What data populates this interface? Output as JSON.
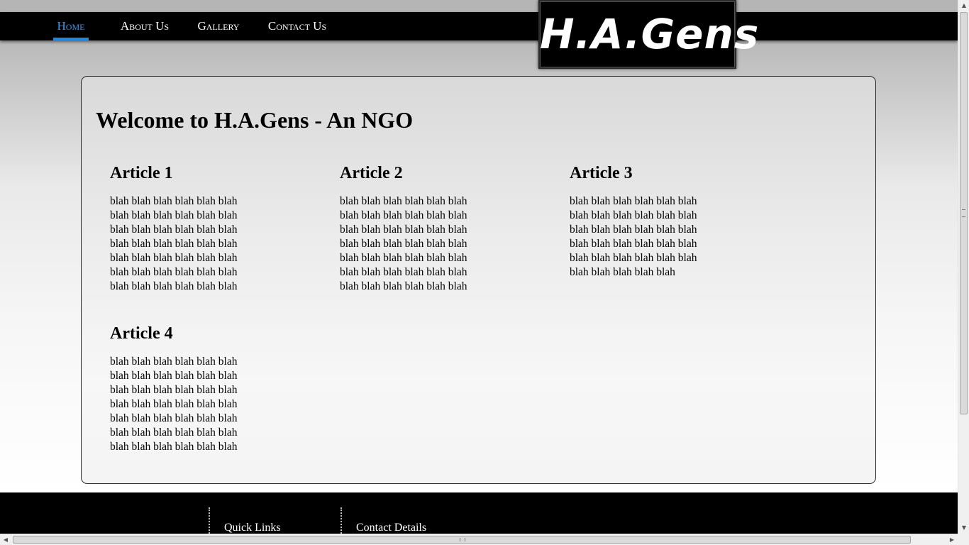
{
  "nav": {
    "items": [
      {
        "label": "Home",
        "active": true
      },
      {
        "label": "About Us",
        "active": false
      },
      {
        "label": "Gallery",
        "active": false
      },
      {
        "label": "Contact Us",
        "active": false
      }
    ],
    "active_color": "#1f88e0"
  },
  "logo": {
    "text": "H.A.Gens"
  },
  "main": {
    "title": "Welcome to H.A.Gens - An NGO",
    "articles": [
      {
        "title": "Article 1",
        "body": "blah blah blah blah blah blah blah blah blah blah blah blah blah blah blah blah blah blah blah blah blah blah blah blah blah blah blah blah blah blah blah blah blah blah blah blah blah blah blah blah blah blah"
      },
      {
        "title": "Article 2",
        "body": "blah blah blah blah blah blah blah blah blah blah blah blah blah blah blah blah blah blah blah blah blah blah blah blah blah blah blah blah blah blah blah blah blah blah blah blah blah blah blah blah blah blah"
      },
      {
        "title": "Article 3",
        "body": "blah blah blah blah blah blah blah blah blah blah blah blah blah blah blah blah blah blah blah blah blah blah blah blah blah blah blah blah blah blah blah blah blah blah blah"
      },
      {
        "title": "Article 4",
        "body": "blah blah blah blah blah blah blah blah blah blah blah blah blah blah blah blah blah blah blah blah blah blah blah blah blah blah blah blah blah blah blah blah blah blah blah blah blah blah blah blah blah blah"
      }
    ]
  },
  "footer": {
    "quick_links_heading": "Quick Links",
    "contact_heading": "Contact Details"
  }
}
